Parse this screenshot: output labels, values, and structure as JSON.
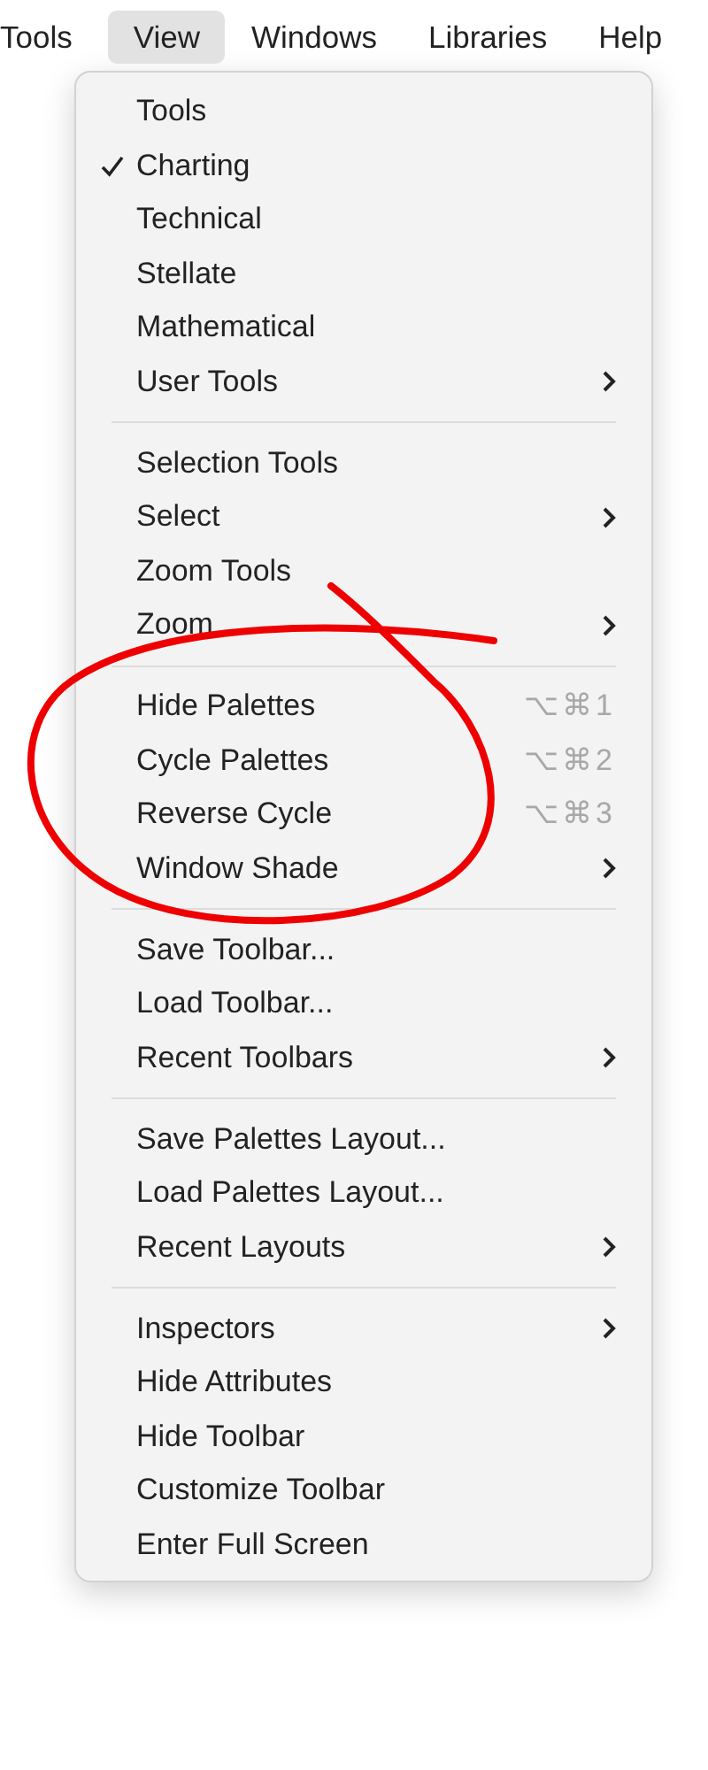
{
  "menubar": [
    {
      "label": "Tools",
      "selected": false
    },
    {
      "label": "View",
      "selected": true
    },
    {
      "label": "Windows",
      "selected": false
    },
    {
      "label": "Libraries",
      "selected": false
    },
    {
      "label": "Help",
      "selected": false
    }
  ],
  "menu": {
    "groups": [
      [
        {
          "label": "Tools",
          "checked": false,
          "submenu": false
        },
        {
          "label": "Charting",
          "checked": true,
          "submenu": false
        },
        {
          "label": "Technical",
          "checked": false,
          "submenu": false
        },
        {
          "label": "Stellate",
          "checked": false,
          "submenu": false
        },
        {
          "label": "Mathematical",
          "checked": false,
          "submenu": false
        },
        {
          "label": "User Tools",
          "checked": false,
          "submenu": true
        }
      ],
      [
        {
          "label": "Selection Tools",
          "checked": false,
          "submenu": false
        },
        {
          "label": "Select",
          "checked": false,
          "submenu": true
        },
        {
          "label": "Zoom Tools",
          "checked": false,
          "submenu": false
        },
        {
          "label": "Zoom",
          "checked": false,
          "submenu": true
        }
      ],
      [
        {
          "label": "Hide Palettes",
          "checked": false,
          "submenu": false,
          "shortcut": "⌥⌘1"
        },
        {
          "label": "Cycle Palettes",
          "checked": false,
          "submenu": false,
          "shortcut": "⌥⌘2"
        },
        {
          "label": "Reverse Cycle",
          "checked": false,
          "submenu": false,
          "shortcut": "⌥⌘3"
        },
        {
          "label": "Window Shade",
          "checked": false,
          "submenu": true
        }
      ],
      [
        {
          "label": "Save Toolbar...",
          "checked": false,
          "submenu": false
        },
        {
          "label": "Load Toolbar...",
          "checked": false,
          "submenu": false
        },
        {
          "label": "Recent Toolbars",
          "checked": false,
          "submenu": true
        }
      ],
      [
        {
          "label": "Save Palettes Layout...",
          "checked": false,
          "submenu": false
        },
        {
          "label": "Load Palettes Layout...",
          "checked": false,
          "submenu": false
        },
        {
          "label": "Recent Layouts",
          "checked": false,
          "submenu": true
        }
      ],
      [
        {
          "label": "Inspectors",
          "checked": false,
          "submenu": true
        },
        {
          "label": "Hide Attributes",
          "checked": false,
          "submenu": false
        },
        {
          "label": "Hide Toolbar",
          "checked": false,
          "submenu": false
        },
        {
          "label": "Customize Toolbar",
          "checked": false,
          "submenu": false
        },
        {
          "label": "Enter Full Screen",
          "checked": false,
          "submenu": false
        }
      ]
    ]
  }
}
